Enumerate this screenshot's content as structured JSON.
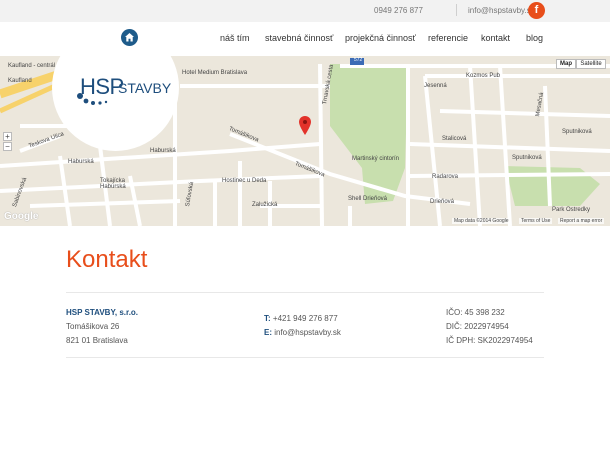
{
  "topbar": {
    "phone": "0949 276 877",
    "email": "info@hspstavby.sk",
    "facebook_glyph": "f"
  },
  "nav": {
    "items": [
      "náš tím",
      "stavebná činnosť",
      "projekčná činnosť",
      "referencie",
      "kontakt",
      "blog"
    ]
  },
  "logo": {
    "hsp": "HSP",
    "stavby": "STAVBY"
  },
  "map": {
    "type_buttons": [
      "Map",
      "Satellite"
    ],
    "zoom_in": "+",
    "zoom_out": "−",
    "google": "Google",
    "attribution": [
      "Map data ©2014 Google",
      "Terms of Use",
      "Report a map error"
    ],
    "labels": {
      "kaufland": "Kaufland",
      "kaufland_centrum": "Kaufland - centrál",
      "hotel_medium": "Hotel Medium Bratislava",
      "teskova": "Teskova Ulica",
      "tomasikova_1": "Tomášikova",
      "tomasikova_2": "Tomášikova",
      "haburska_1": "Haburská",
      "haburska_2": "Haburská",
      "haburska_3": "Haburská",
      "tokajicka": "Tokajícka",
      "hostinec": "Hostinec u Deda",
      "sabinovska": "Sabinovská",
      "sulovska": "Súľovská",
      "zaluzicka": "Zalužická",
      "trnavska": "Trnavská cesta",
      "jesenna": "Jesenná",
      "kozmos": "Kozmos Pub",
      "martinsky": "Martinský cintorín",
      "shell": "Shell Drieňová",
      "drienova": "Drieňová",
      "stalicova": "Stalicová",
      "radarova": "Radarova",
      "sputnikova_1": "Sputniková",
      "sputnikova_2": "Sputniková",
      "mesacna": "Mesačná",
      "park": "Park Ostredky",
      "road_572": "572"
    }
  },
  "content": {
    "heading": "Kontakt",
    "company": "HSP STAVBY, s.r.o.",
    "street": "Tomášikova 26",
    "city": "821 01 Bratislava",
    "phone_key": "T:",
    "phone": "+421 949 276 877",
    "email_key": "E:",
    "email": "info@hspstavby.sk",
    "ico": "IČO: 45 398 232",
    "dic": "DIČ: 2022974954",
    "icdph": "IČ DPH: SK2022974954"
  },
  "colors": {
    "accent": "#e84e1b",
    "brand": "#1e4e7d",
    "map_bg": "#ece7dc",
    "park": "#c8dfae"
  }
}
